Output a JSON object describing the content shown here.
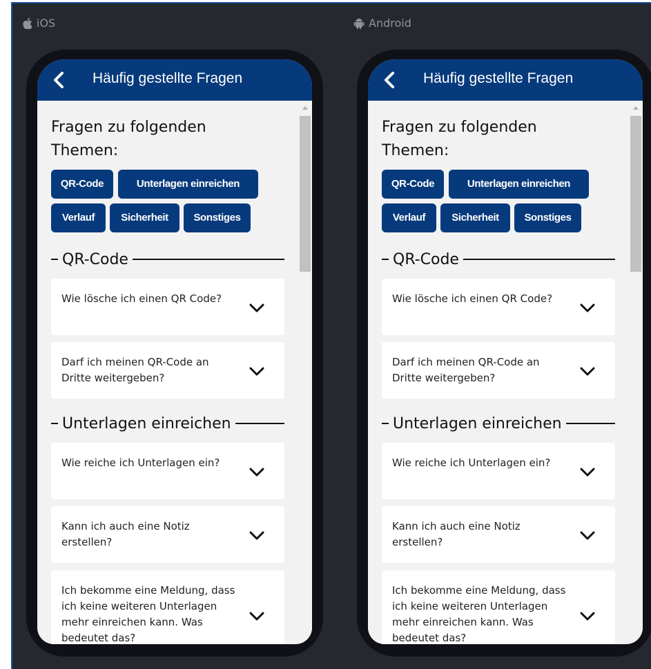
{
  "platforms": [
    {
      "label": "iOS",
      "icon": "apple-icon"
    },
    {
      "label": "Android",
      "icon": "android-icon"
    }
  ],
  "appbar": {
    "title": "Häufig gestellte Fragen",
    "back_icon": "chevron-left-icon"
  },
  "topics": {
    "heading": "Fragen zu folgenden Themen:",
    "chips": [
      "QR-Code",
      "Unterlagen einreichen",
      "Verlauf",
      "Sicherheit",
      "Sonstiges"
    ]
  },
  "sections": [
    {
      "title": "QR-Code",
      "questions": [
        "Wie lösche ich einen QR Code?",
        "Darf ich meinen QR-Code an Dritte weitergeben?"
      ]
    },
    {
      "title": "Unterlagen einreichen",
      "questions": [
        "Wie reiche ich Unterlagen ein?",
        "Kann ich auch eine Notiz erstellen?",
        "Ich bekomme eine Meldung, dass ich keine weiteren Unterlagen mehr einreichen kann. Was bedeutet das?"
      ]
    }
  ],
  "colors": {
    "primary": "#063a7c",
    "background": "#25282e",
    "screen": "#f2f2f2",
    "card": "#ffffff"
  }
}
